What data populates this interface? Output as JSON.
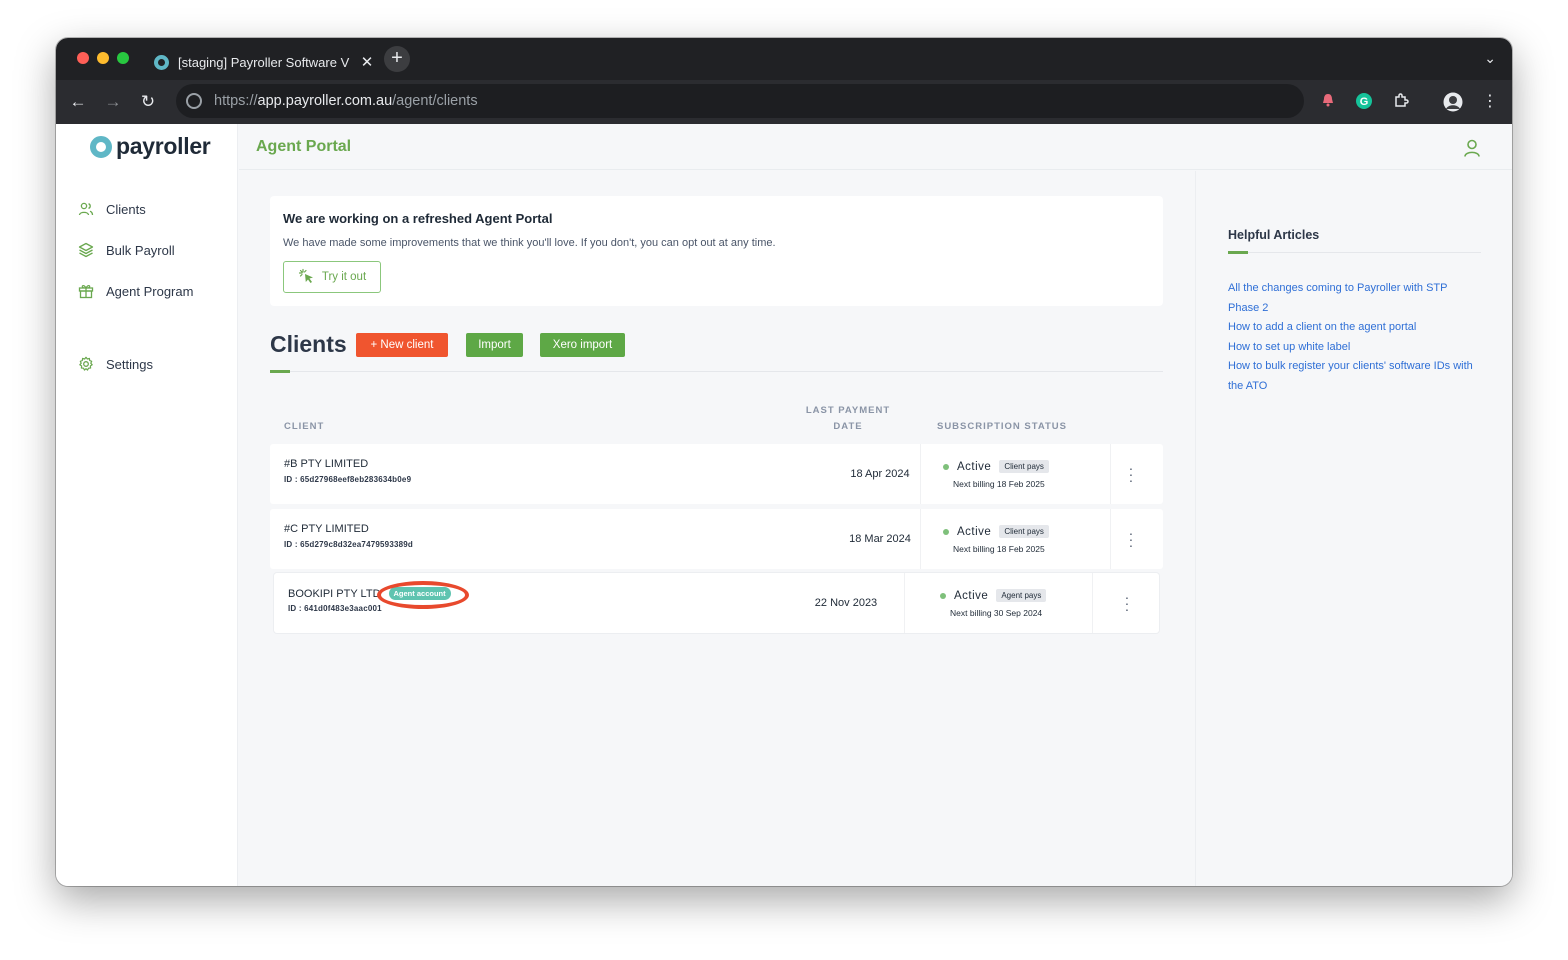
{
  "browser": {
    "tab_title": "[staging] Payroller Software V",
    "url_scheme": "https://",
    "url_host": "app.payroller.com.au",
    "url_path": "/agent/clients",
    "traffic_colors": [
      "#ff5f57",
      "#febc2e",
      "#28c840"
    ]
  },
  "app": {
    "logo_text": "payroller",
    "portal_title": "Agent Portal",
    "accent_color": "#6aa84f"
  },
  "sidebar": {
    "items": [
      {
        "label": "Clients",
        "icon": "users-icon"
      },
      {
        "label": "Bulk Payroll",
        "icon": "layers-icon"
      },
      {
        "label": "Agent Program",
        "icon": "gift-icon"
      },
      {
        "label": "Settings",
        "icon": "gear-icon"
      }
    ]
  },
  "banner": {
    "title": "We are working on a refreshed Agent Portal",
    "text": "We have made some improvements that we think you'll love. If you don't, you can opt out at any time.",
    "button_label": "Try it out"
  },
  "clients": {
    "title": "Clients",
    "new_client_label": "+ New client",
    "import_label": "Import",
    "xero_import_label": "Xero import",
    "columns": {
      "client": "CLIENT",
      "last_payment_line1": "LAST PAYMENT",
      "last_payment_line2": "DATE",
      "subscription_status": "SUBSCRIPTION STATUS"
    },
    "rows": [
      {
        "name": "#B PTY LIMITED",
        "id": "ID : 65d27968eef8eb283634b0e9",
        "last_payment": "18 Apr 2024",
        "status": "Active",
        "payer": "Client pays",
        "billing": "Next billing 18 Feb 2025"
      },
      {
        "name": "#C PTY LIMITED",
        "id": "ID : 65d279c8d32ea7479593389d",
        "last_payment": "18 Mar 2024",
        "status": "Active",
        "payer": "Client pays",
        "billing": "Next billing 18 Feb 2025"
      },
      {
        "name": "BOOKIPI PTY LTD",
        "badge": "Agent account",
        "id": "ID : 641d0f483e3aac001",
        "last_payment": "22 Nov 2023",
        "status": "Active",
        "payer": "Agent pays",
        "billing": "Next billing 30 Sep 2024"
      }
    ]
  },
  "help": {
    "title": "Helpful Articles",
    "links": [
      "All the changes coming to Payroller with STP Phase 2",
      "How to add a client on the agent portal",
      "How to set up white label",
      "How to bulk register your clients' software IDs with the ATO"
    ]
  }
}
